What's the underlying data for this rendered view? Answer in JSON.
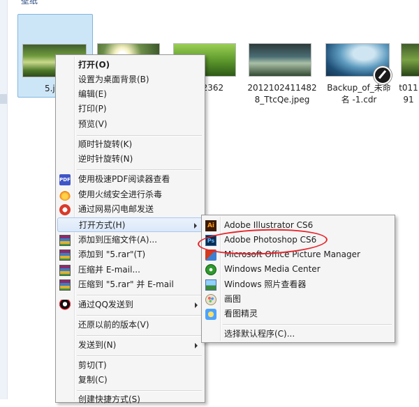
{
  "explorer": {
    "group_header": "壁纸",
    "files": [
      {
        "name": "5.jpg",
        "thumb": "forest-waterfall",
        "selected": true
      },
      {
        "name": "",
        "thumb": "sunlit-forest"
      },
      {
        "name": "2012102362\n.jpg",
        "thumb": "green-landscape"
      },
      {
        "name": "2012102411482\n8_TtcQe.jpeg",
        "thumb": "coastal-dusk"
      },
      {
        "name": "Backup_of_未命\n名 -1.cdr",
        "thumb": "ocean-view"
      },
      {
        "name": "t011\n91",
        "thumb": "forest-trees"
      }
    ]
  },
  "context_menu": {
    "items": [
      {
        "label": "打开(O)",
        "bold": true
      },
      {
        "label": "设置为桌面背景(B)"
      },
      {
        "label": "编辑(E)"
      },
      {
        "label": "打印(P)"
      },
      {
        "label": "预览(V)"
      },
      {
        "label": "顺时针旋转(K)"
      },
      {
        "label": "逆时针旋转(N)"
      },
      {
        "label": "使用极速PDF阅读器查看",
        "icon": "pdf-icon"
      },
      {
        "label": "使用火绒安全进行杀毒",
        "icon": "huorong-icon"
      },
      {
        "label": "通过网易闪电邮发送",
        "icon": "netease-mail-icon"
      },
      {
        "label": "打开方式(H)",
        "submenu": true,
        "hover": true
      },
      {
        "label": "添加到压缩文件(A)...",
        "icon": "winrar-icon"
      },
      {
        "label": "添加到 \"5.rar\"(T)",
        "icon": "winrar-icon"
      },
      {
        "label": "压缩并 E-mail...",
        "icon": "winrar-icon"
      },
      {
        "label": "压缩到 \"5.rar\" 并 E-mail",
        "icon": "winrar-icon"
      },
      {
        "label": "通过QQ发送到",
        "icon": "qq-icon",
        "submenu": true
      },
      {
        "label": "还原以前的版本(V)"
      },
      {
        "label": "发送到(N)",
        "submenu": true
      },
      {
        "label": "剪切(T)"
      },
      {
        "label": "复制(C)"
      },
      {
        "label": "创建快捷方式(S)"
      }
    ]
  },
  "open_with_menu": {
    "items": [
      {
        "label": "Adobe Illustrator CS6",
        "icon": "illustrator-icon"
      },
      {
        "label": "Adobe Photoshop CS6",
        "icon": "photoshop-icon",
        "highlighted": true
      },
      {
        "label": "Microsoft Office Picture Manager",
        "icon": "office-picture-manager-icon"
      },
      {
        "label": "Windows Media Center",
        "icon": "windows-media-center-icon"
      },
      {
        "label": "Windows 照片查看器",
        "icon": "photo-viewer-icon"
      },
      {
        "label": "画图",
        "icon": "paint-icon"
      },
      {
        "label": "看图精灵",
        "icon": "kantu-icon"
      },
      {
        "label": "选择默认程序(C)..."
      }
    ],
    "annotation_color": "#e8232a"
  }
}
